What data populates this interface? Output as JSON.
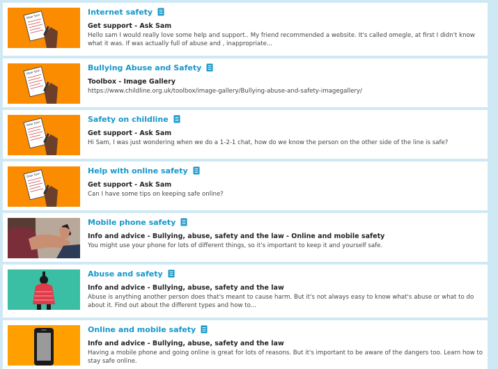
{
  "colors": {
    "accent": "#1697c9",
    "orange_thumb": "#fb8c00",
    "teal_thumb": "#3bbfa4",
    "page_bg": "#cfe9f4"
  },
  "results": [
    {
      "title": "Internet safety",
      "category": "Get support - Ask Sam",
      "snippet": "Hello sam I would really love some help and support.. My friend recommended a website. It's called omegle, at first I didn't know what it was. If was actually full of abuse and , inappropriate...",
      "thumb_icon": "ask-sam-letter-icon",
      "thumb_note_text": "Dear Sam"
    },
    {
      "title": "Bullying Abuse and Safety",
      "category": "Toolbox - Image Gallery",
      "snippet": "https://www.childline.org.uk/toolbox/image-gallery/Bullying-abuse-and-safety-imagegallery/",
      "thumb_icon": "ask-sam-letter-icon",
      "thumb_note_text": "Dear Sam"
    },
    {
      "title": "Safety on childline",
      "category": "Get support - Ask Sam",
      "snippet": "Hi Sam, I was just wondering when we do a 1-2-1 chat, how do we know the person on the other side of the line is safe?",
      "thumb_icon": "ask-sam-letter-icon",
      "thumb_note_text": "Dear Sam"
    },
    {
      "title": "Help with online safety",
      "category": "Get support - Ask Sam",
      "snippet": "Can I have some tips on keeping safe online?",
      "thumb_icon": "ask-sam-letter-icon",
      "thumb_note_text": "Dear Sam"
    },
    {
      "title": "Mobile phone safety",
      "category": "Info and advice - Bullying, abuse, safety and the law - Online and mobile safety",
      "snippet": "You might use your phone for lots of different things, so it's important to keep it and yourself safe.",
      "thumb_icon": "person-with-phone-photo"
    },
    {
      "title": "Abuse and safety",
      "category": "Info and advice - Bullying, abuse, safety and the law",
      "snippet": "Abuse is anything another person does that's meant to cause harm. But it's not always easy to know what's abuse or what to do about it. Find out about the different types and how to...",
      "thumb_icon": "hooded-figure-illustration"
    },
    {
      "title": "Online and mobile safety",
      "category": "Info and advice - Bullying, abuse, safety and the law",
      "snippet": "Having a mobile phone and going online is great for lots of reasons. But it's important to be aware of the dangers too. Learn how to stay safe online.",
      "thumb_icon": "mobile-phone-illustration"
    }
  ]
}
